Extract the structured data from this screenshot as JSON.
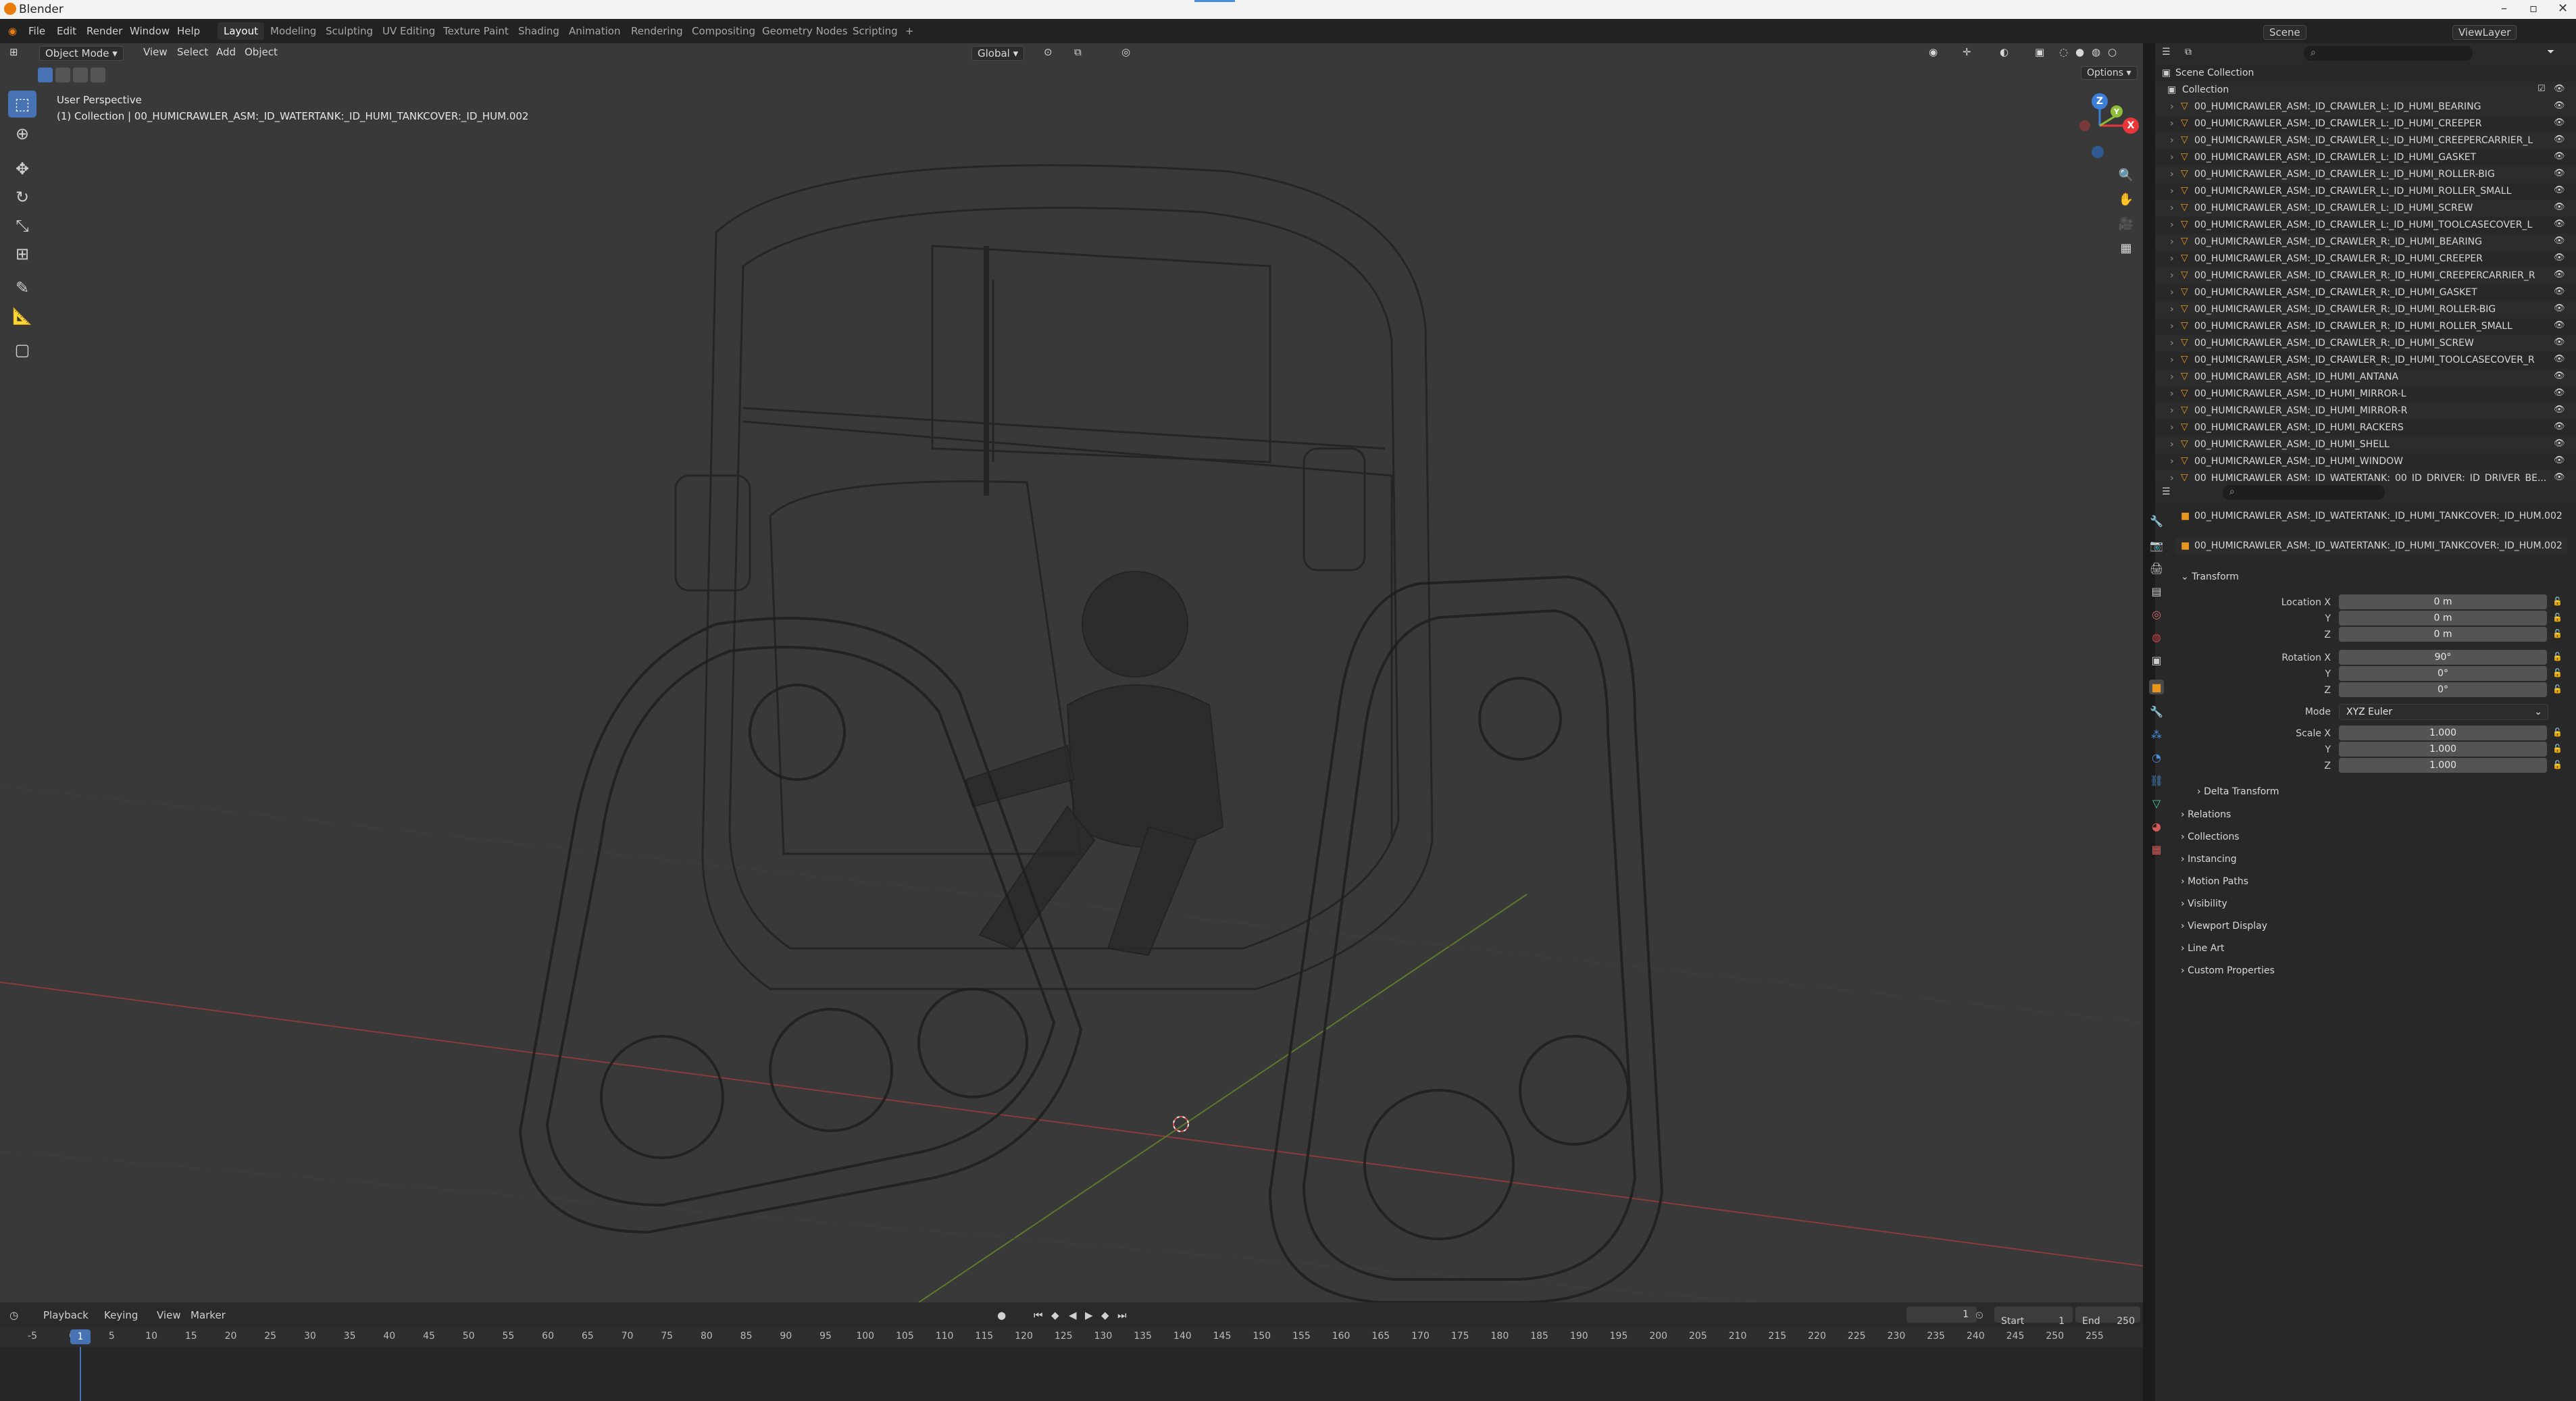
{
  "title_bar": {
    "app_title": "Blender",
    "min": "–",
    "max": "▫",
    "close": "✕"
  },
  "menu": {
    "items": [
      "File",
      "Edit",
      "Render",
      "Window",
      "Help"
    ],
    "workspaces": [
      "Layout",
      "Modeling",
      "Sculpting",
      "UV Editing",
      "Texture Paint",
      "Shading",
      "Animation",
      "Rendering",
      "Compositing",
      "Geometry Nodes",
      "Scripting",
      "+"
    ],
    "scene": "Scene",
    "view_layer": "ViewLayer"
  },
  "viewport": {
    "mode": "Object Mode",
    "menus": [
      "View",
      "Select",
      "Add",
      "Object"
    ],
    "orientation": "Global",
    "options": "Options",
    "info_line1": "User Perspective",
    "info_line2": "(1) Collection | 00_HUMICRAWLER_ASM:_ID_WATERTANK:_ID_HUMI_TANKCOVER:_ID_HUM.002",
    "gizmo": {
      "z": "Z",
      "x": "X",
      "y": "Y"
    }
  },
  "timeline": {
    "menus": [
      "Playback",
      "Keying",
      "View",
      "Marker"
    ],
    "current_frame": "1",
    "start_label": "Start",
    "start": "1",
    "end_label": "End",
    "end": "250",
    "ticks": [
      "-5",
      "0",
      "5",
      "10",
      "15",
      "20",
      "25",
      "30",
      "35",
      "40",
      "45",
      "50",
      "55",
      "60",
      "65",
      "70",
      "75",
      "80",
      "85",
      "90",
      "95",
      "100",
      "105",
      "110",
      "115",
      "120",
      "125",
      "130",
      "135",
      "140",
      "145",
      "150",
      "155",
      "160",
      "165",
      "170",
      "175",
      "180",
      "185",
      "190",
      "195",
      "200",
      "205",
      "210",
      "215",
      "220",
      "225",
      "230",
      "235",
      "240",
      "245",
      "250",
      "255"
    ]
  },
  "outliner": {
    "scene_collection": "Scene Collection",
    "collection": "Collection",
    "items": [
      "00_HUMICRAWLER_ASM:_ID_CRAWLER_L:_ID_HUMI_BEARING",
      "00_HUMICRAWLER_ASM:_ID_CRAWLER_L:_ID_HUMI_CREEPER",
      "00_HUMICRAWLER_ASM:_ID_CRAWLER_L:_ID_HUMI_CREEPERCARRIER_L",
      "00_HUMICRAWLER_ASM:_ID_CRAWLER_L:_ID_HUMI_GASKET",
      "00_HUMICRAWLER_ASM:_ID_CRAWLER_L:_ID_HUMI_ROLLER-BIG",
      "00_HUMICRAWLER_ASM:_ID_CRAWLER_L:_ID_HUMI_ROLLER_SMALL",
      "00_HUMICRAWLER_ASM:_ID_CRAWLER_L:_ID_HUMI_SCREW",
      "00_HUMICRAWLER_ASM:_ID_CRAWLER_L:_ID_HUMI_TOOLCASECOVER_L",
      "00_HUMICRAWLER_ASM:_ID_CRAWLER_R:_ID_HUMI_BEARING",
      "00_HUMICRAWLER_ASM:_ID_CRAWLER_R:_ID_HUMI_CREEPER",
      "00_HUMICRAWLER_ASM:_ID_CRAWLER_R:_ID_HUMI_CREEPERCARRIER_R",
      "00_HUMICRAWLER_ASM:_ID_CRAWLER_R:_ID_HUMI_GASKET",
      "00_HUMICRAWLER_ASM:_ID_CRAWLER_R:_ID_HUMI_ROLLER-BIG",
      "00_HUMICRAWLER_ASM:_ID_CRAWLER_R:_ID_HUMI_ROLLER_SMALL",
      "00_HUMICRAWLER_ASM:_ID_CRAWLER_R:_ID_HUMI_SCREW",
      "00_HUMICRAWLER_ASM:_ID_CRAWLER_R:_ID_HUMI_TOOLCASECOVER_R",
      "00_HUMICRAWLER_ASM:_ID_HUMI_ANTANA",
      "00_HUMICRAWLER_ASM:_ID_HUMI_MIRROR-L",
      "00_HUMICRAWLER_ASM:_ID_HUMI_MIRROR-R",
      "00_HUMICRAWLER_ASM:_ID_HUMI_RACKERS",
      "00_HUMICRAWLER_ASM:_ID_HUMI_SHELL",
      "00_HUMICRAWLER_ASM:_ID_HUMI_WINDOW",
      "00_HUMICRAWLER_ASM:_ID_WATERTANK:_00_ID_DRIVER:_ID_DRIVER_BE..."
    ]
  },
  "properties": {
    "object_name": "00_HUMICRAWLER_ASM:_ID_WATERTANK:_ID_HUMI_TANKCOVER:_ID_HUM.002",
    "object_field": "00_HUMICRAWLER_ASM:_ID_WATERTANK:_ID_HUMI_TANKCOVER:_ID_HUM.002",
    "transform_label": "Transform",
    "location": {
      "label_x": "Location X",
      "label_y": "Y",
      "label_z": "Z",
      "x": "0 m",
      "y": "0 m",
      "z": "0 m"
    },
    "rotation": {
      "label_x": "Rotation X",
      "label_y": "Y",
      "label_z": "Z",
      "x": "90°",
      "y": "0°",
      "z": "0°"
    },
    "mode": {
      "label": "Mode",
      "value": "XYZ Euler"
    },
    "scale": {
      "label_x": "Scale X",
      "label_y": "Y",
      "label_z": "Z",
      "x": "1.000",
      "y": "1.000",
      "z": "1.000"
    },
    "delta_transform": "Delta Transform",
    "panels": [
      "Relations",
      "Collections",
      "Instancing",
      "Motion Paths",
      "Visibility",
      "Viewport Display",
      "Line Art",
      "Custom Properties"
    ]
  },
  "colors": {
    "accent": "#4772b3",
    "mesh_icon": "#4cc49e",
    "object_icon": "#e8961e",
    "x_axis": "#e8363b",
    "y_axis": "#8dbf3a",
    "z_axis": "#3d7fd6"
  }
}
